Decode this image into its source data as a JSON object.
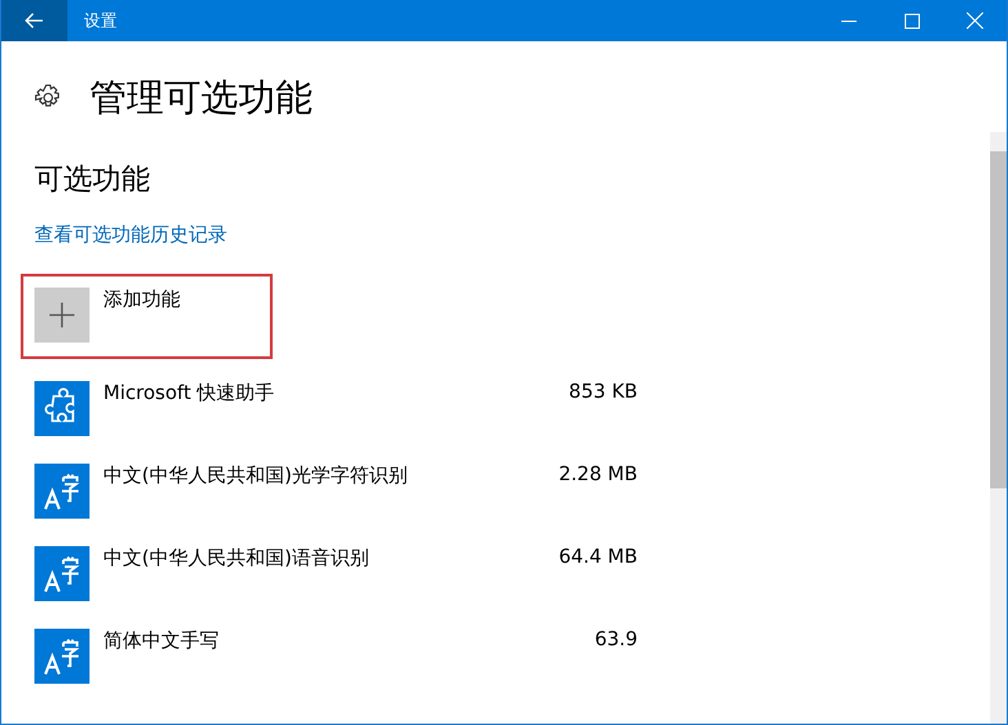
{
  "window": {
    "title": "设置"
  },
  "page_title": "管理可选功能",
  "section_title": "可选功能",
  "history_link": "查看可选功能历史记录",
  "add_feature": {
    "label": "添加功能",
    "highlighted": true
  },
  "features": [
    {
      "name": "Microsoft 快速助手",
      "size": "853 KB",
      "kind": "puzzle"
    },
    {
      "name": "中文(中华人民共和国)光学字符识别",
      "size": "2.28 MB",
      "kind": "language"
    },
    {
      "name": "中文(中华人民共和国)语音识别",
      "size": "64.4 MB",
      "kind": "language"
    },
    {
      "name": "简体中文手写",
      "size": "63.9",
      "kind": "language"
    }
  ]
}
